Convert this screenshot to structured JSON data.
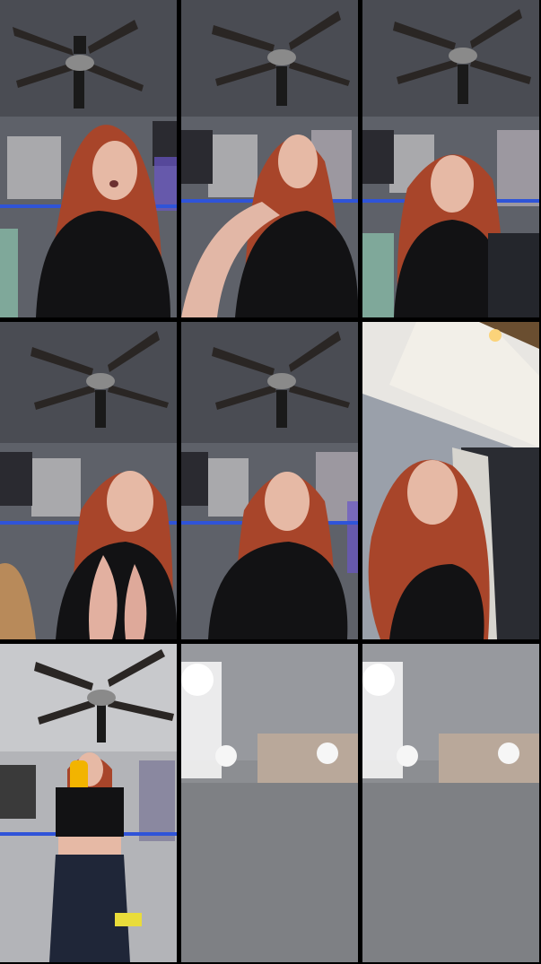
{
  "grid": {
    "rows": 3,
    "columns": 3
  },
  "frames": [
    {
      "scene": "ceiling-fan-room-talking"
    },
    {
      "scene": "ceiling-fan-room-gesture"
    },
    {
      "scene": "ceiling-fan-room-neutral"
    },
    {
      "scene": "ceiling-fan-room-clapping"
    },
    {
      "scene": "ceiling-fan-room-leaning"
    },
    {
      "scene": "low-angle-looking-up"
    },
    {
      "scene": "standing-drinking-bottle"
    },
    {
      "scene": "ceiling-lights"
    },
    {
      "scene": "ceiling-lights"
    }
  ],
  "colors": {
    "hair": "#a8452a",
    "shirt": "#121214",
    "ceiling": "#4a4c53",
    "wall": "#6b6e76",
    "blue_led": "#2f54d8",
    "skin": "#e6b9a5"
  }
}
